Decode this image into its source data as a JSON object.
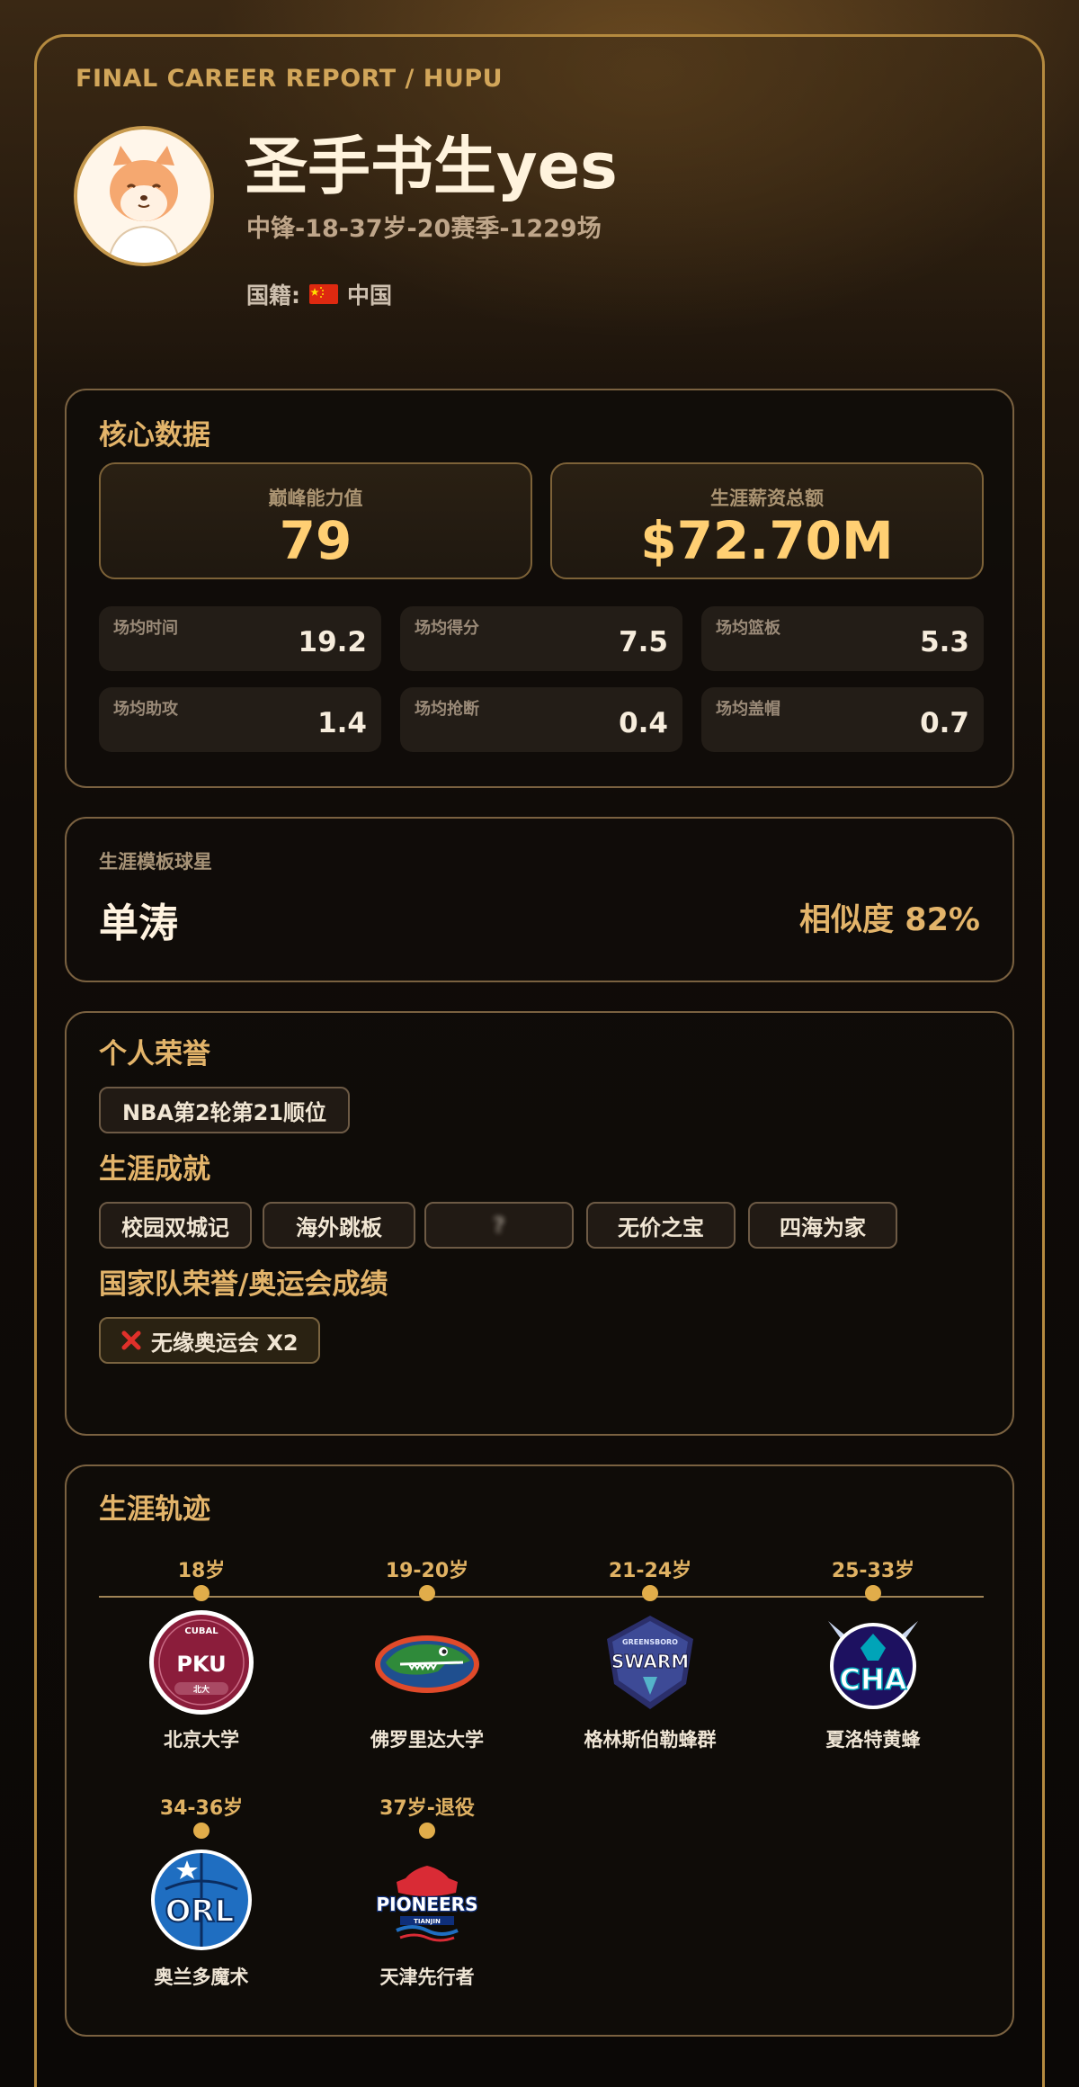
{
  "header": {
    "kicker": "FINAL CAREER REPORT / HUPU",
    "name": "圣手书生yes",
    "subtitle": "中锋-18-37岁-20赛季-1229场",
    "nationality_label": "国籍:",
    "nationality_value": "中国"
  },
  "core": {
    "title": "核心数据",
    "peak_label": "巅峰能力值",
    "peak_value": "79",
    "salary_label": "生涯薪资总额",
    "salary_value": "$72.70M",
    "stats": [
      {
        "label": "场均时间",
        "value": "19.2"
      },
      {
        "label": "场均得分",
        "value": "7.5"
      },
      {
        "label": "场均篮板",
        "value": "5.3"
      },
      {
        "label": "场均助攻",
        "value": "1.4"
      },
      {
        "label": "场均抢断",
        "value": "0.4"
      },
      {
        "label": "场均盖帽",
        "value": "0.7"
      }
    ]
  },
  "template": {
    "label": "生涯模板球星",
    "player": "单涛",
    "similarity": "相似度 82%"
  },
  "honors": {
    "personal_title": "个人荣誉",
    "personal": [
      "NBA第2轮第21顺位"
    ],
    "achievements_title": "生涯成就",
    "achievements": [
      "校园双城记",
      "海外跳板",
      "?",
      "无价之宝",
      "四海为家"
    ],
    "national_title": "国家队荣誉/奥运会成绩",
    "national": "无缘奥运会 X2"
  },
  "career": {
    "title": "生涯轨迹",
    "stops": [
      {
        "age": "18岁",
        "team": "北京大学",
        "logo": "pku-logo",
        "logo_top": "CUBAL",
        "logo_main": "PKU",
        "logo_bottom": "北大"
      },
      {
        "age": "19-20岁",
        "team": "佛罗里达大学",
        "logo": "gator-logo"
      },
      {
        "age": "21-24岁",
        "team": "格林斯伯勒蜂群",
        "logo": "swarm-logo",
        "logo_top": "GREENSBORO",
        "logo_main": "SWARM"
      },
      {
        "age": "25-33岁",
        "team": "夏洛特黄蜂",
        "logo": "hornets-logo",
        "logo_main": "CHA"
      },
      {
        "age": "34-36岁",
        "team": "奥兰多魔术",
        "logo": "magic-logo",
        "logo_main": "ORL"
      },
      {
        "age": "37岁-退役",
        "team": "天津先行者",
        "logo": "pioneers-logo",
        "logo_main": "PIONEERS",
        "logo_bottom": "TIANJIN"
      }
    ]
  },
  "colors": {
    "accent_gold": "#e3b46a",
    "value_gold": "#ffcf73",
    "border": "#7a6140",
    "background": "#0d0906"
  }
}
